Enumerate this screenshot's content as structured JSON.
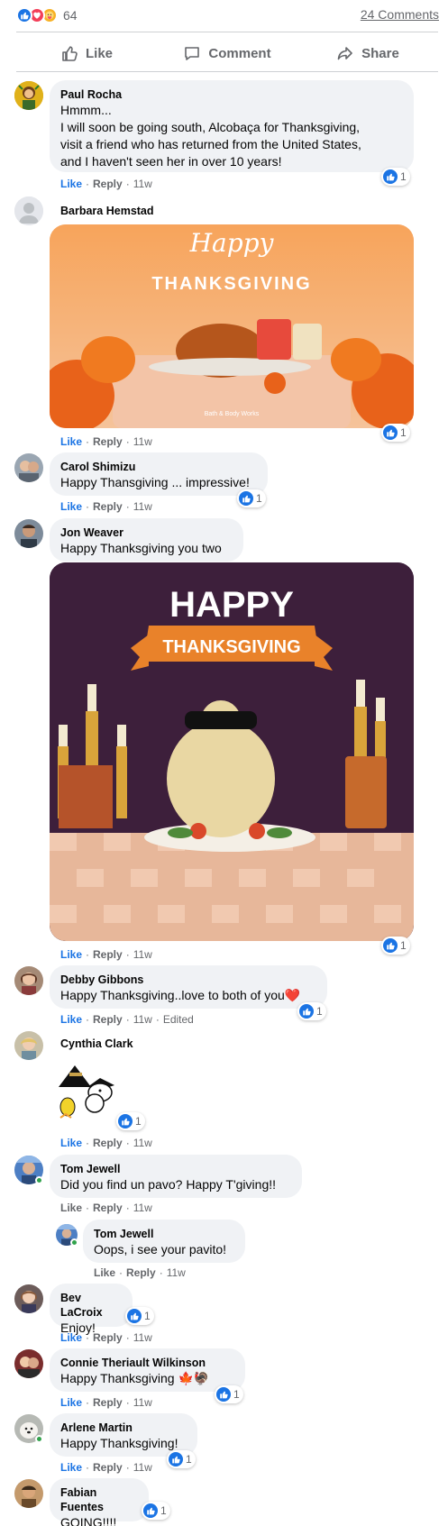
{
  "summary": {
    "reaction_count": "64",
    "comments_link": "24 Comments",
    "reaction_types": [
      "like",
      "love",
      "care"
    ]
  },
  "actions": {
    "like": "Like",
    "comment": "Comment",
    "share": "Share"
  },
  "labels": {
    "like": "Like",
    "reply": "Reply",
    "dot": "·",
    "edited": "Edited"
  },
  "comments": [
    {
      "author": "Paul Rocha",
      "text": [
        "Hmmm...",
        "I will soon be going south, Alcobaça for Thanksgiving,",
        "visit a friend who has returned from the United States,",
        "and I haven't seen her in over 10 years!"
      ],
      "time": "11w",
      "likes": "1",
      "liked": true
    },
    {
      "author": "Barbara Hemstad",
      "image": {
        "line1": "Happy",
        "line2": "THANKSGIVING",
        "brand": "Bath & Body Works"
      },
      "time": "11w",
      "likes": "1",
      "liked": true
    },
    {
      "author": "Carol Shimizu",
      "text": "Happy Thansgiving ... impressive!",
      "time": "11w",
      "likes": "1",
      "liked": true
    },
    {
      "author": "Jon Weaver",
      "text": "Happy Thanksgiving you two",
      "gif": {
        "line1": "HAPPY",
        "line2": "THANKSGIVING"
      },
      "time": "11w",
      "likes": "1",
      "liked": true
    },
    {
      "author": "Debby Gibbons",
      "text": "Happy Thanksgiving..love to both of you❤️",
      "time": "11w",
      "edited": true,
      "likes": "1",
      "liked": true
    },
    {
      "author": "Cynthia Clark",
      "sticker": "snoopy-pilgrim",
      "time": "11w",
      "likes": "1",
      "liked": true
    },
    {
      "author": "Tom Jewell",
      "text": "Did you find un pavo? Happy T'giving!!",
      "time": "11w",
      "liked": false
    },
    {
      "author": "Tom Jewell",
      "text": "Oops, i see your pavito!",
      "time": "11w",
      "reply": true,
      "liked": false
    },
    {
      "author": "Bev LaCroix",
      "text": "Enjoy!",
      "time": "11w",
      "likes": "1",
      "liked": true
    },
    {
      "author": "Connie Theriault Wilkinson",
      "text": "Happy Thanksgiving 🍁🦃",
      "time": "11w",
      "likes": "1",
      "liked": true
    },
    {
      "author": "Arlene Martin",
      "text": "Happy Thanksgiving!",
      "time": "11w",
      "likes": "1",
      "liked": true
    },
    {
      "author": "Fabian Fuentes",
      "text": "GOING!!!!",
      "likes": "1"
    }
  ],
  "colors": {
    "accent": "#1b74e4",
    "bubble": "#f0f2f5",
    "muted": "#65676b"
  }
}
